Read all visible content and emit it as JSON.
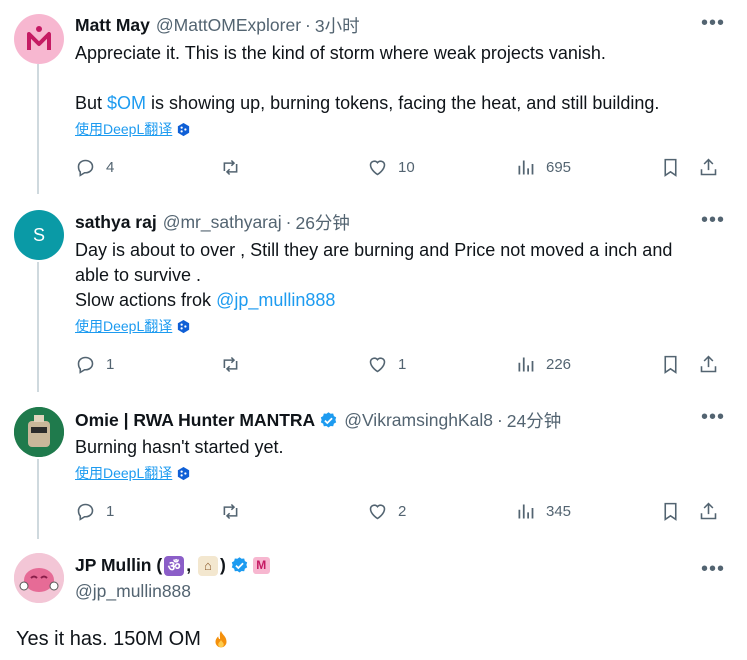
{
  "tweets": [
    {
      "name": "Matt May",
      "handle": "@MattOMExplorer",
      "time": "3小时",
      "text_line1": "Appreciate it. This is the kind of storm where weak projects vanish.",
      "text_line2_pre": "But ",
      "text_line2_link": "$OM",
      "text_line2_post": " is showing up, burning tokens, facing the heat, and still building.",
      "translate": "使用DeepL翻译",
      "replies": "4",
      "likes": "10",
      "views": "695"
    },
    {
      "name": "sathya raj",
      "handle": "@mr_sathyaraj",
      "time": "26分钟",
      "avatar_letter": "S",
      "text_line1": "Day is about to over , Still they are burning and Price not moved a inch and",
      "text_line2": "able to survive .",
      "text_line3_pre": "Slow actions frok ",
      "text_line3_link": "@jp_mullin888",
      "translate": "使用DeepL翻译",
      "replies": "1",
      "likes": "1",
      "views": "226"
    },
    {
      "name": "Omie | RWA Hunter MANTRA",
      "handle": "@VikramsinghKal8",
      "time": "24分钟",
      "text_line1": "Burning hasn't started yet.",
      "translate": "使用DeepL翻译",
      "replies": "1",
      "likes": "2",
      "views": "345"
    }
  ],
  "main_tweet": {
    "name_pre": "JP Mullin (",
    "name_mid": ",",
    "name_post": ")",
    "handle": "@jp_mullin888",
    "text": "Yes it has. 150M OM"
  },
  "colors": {
    "accent": "#1d9bf0",
    "muted": "#536471",
    "text": "#0f1419"
  }
}
